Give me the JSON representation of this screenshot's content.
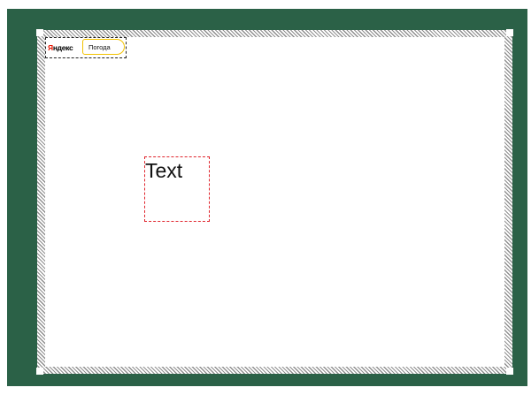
{
  "canvas": {
    "background_color": "#2b6147"
  },
  "widget": {
    "logo_first_letter": "Я",
    "logo_rest": "ндекс",
    "logo_accent_color": "#e61400",
    "badge_label": "Погода",
    "badge_color": "#f2c200"
  },
  "text_frame": {
    "content": "Text",
    "border_color": "#e0242c"
  }
}
